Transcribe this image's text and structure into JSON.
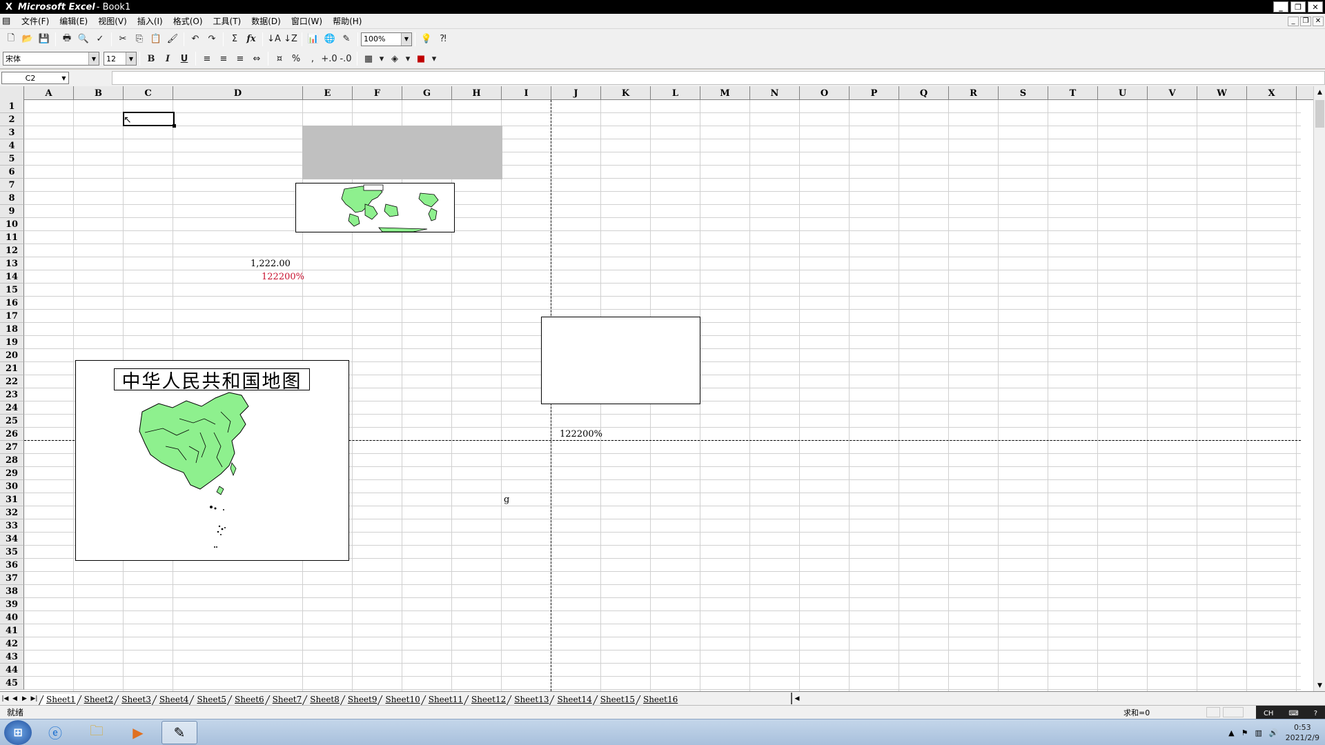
{
  "window": {
    "app_name": "Microsoft Excel",
    "doc_title": "- Book1"
  },
  "menu": [
    "文件(F)",
    "编辑(E)",
    "视图(V)",
    "插入(I)",
    "格式(O)",
    "工具(T)",
    "数据(D)",
    "窗口(W)",
    "帮助(H)"
  ],
  "toolbar": {
    "zoom": "100%",
    "font_name": "宋体",
    "font_size": "12",
    "bold": "B",
    "italic": "I",
    "underline": "U",
    "sum": "Σ",
    "fx": "fx"
  },
  "formula_bar": {
    "name_box": "C2",
    "content": ""
  },
  "columns": [
    "A",
    "B",
    "C",
    "D",
    "E",
    "F",
    "G",
    "H",
    "I",
    "J",
    "K",
    "L",
    "M",
    "N",
    "O",
    "P",
    "Q",
    "R",
    "S",
    "T",
    "U",
    "V",
    "W",
    "X"
  ],
  "rows": [
    "1",
    "2",
    "3",
    "4",
    "5",
    "6",
    "7",
    "8",
    "9",
    "10",
    "11",
    "12",
    "13",
    "14",
    "15",
    "16",
    "17",
    "18",
    "19",
    "20",
    "21",
    "22",
    "23",
    "24",
    "25",
    "26",
    "27",
    "28",
    "29",
    "30",
    "31",
    "32",
    "33",
    "34",
    "35",
    "36",
    "37",
    "38",
    "39",
    "40",
    "41",
    "42",
    "43",
    "44",
    "45"
  ],
  "cells": {
    "d13": "1,222.00",
    "d14": "122200%",
    "j26": "122200%",
    "i31": "g"
  },
  "colors": {
    "red_value": "#c8102e",
    "map_green": "#8ef08e",
    "gray_box": "#c0c0c0"
  },
  "china_map": {
    "title": "中华人民共和国地图"
  },
  "sheet_tabs": [
    "Sheet1",
    "Sheet2",
    "Sheet3",
    "Sheet4",
    "Sheet5",
    "Sheet6",
    "Sheet7",
    "Sheet8",
    "Sheet9",
    "Sheet10",
    "Sheet11",
    "Sheet12",
    "Sheet13",
    "Sheet14",
    "Sheet15",
    "Sheet16"
  ],
  "status": {
    "text": "就绪",
    "sum": "求和=0"
  },
  "taskbar": {
    "time": "0:53",
    "date": "2021/2/9",
    "lang": "CH"
  }
}
